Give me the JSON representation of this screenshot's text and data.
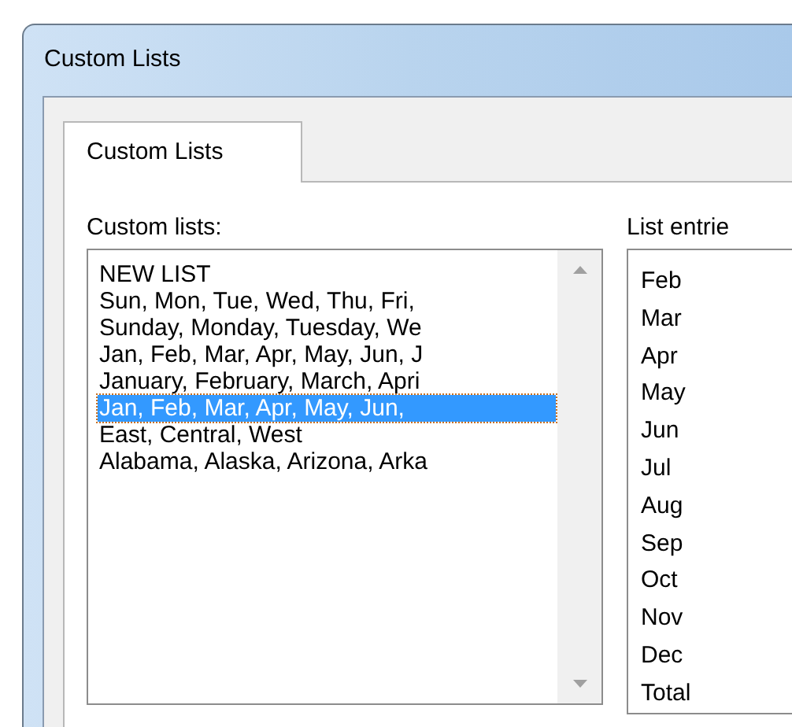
{
  "window": {
    "title": "Custom Lists"
  },
  "tabs": [
    {
      "label": "Custom Lists",
      "selected": true
    }
  ],
  "custom_lists": {
    "label": "Custom lists:",
    "items": [
      {
        "text": "NEW LIST",
        "selected": false
      },
      {
        "text": "Sun, Mon, Tue, Wed, Thu, Fri,",
        "selected": false
      },
      {
        "text": "Sunday, Monday, Tuesday, We",
        "selected": false
      },
      {
        "text": "Jan, Feb, Mar, Apr, May, Jun, J",
        "selected": false
      },
      {
        "text": "January, February, March, Apri",
        "selected": false
      },
      {
        "text": "Jan, Feb, Mar, Apr, May, Jun,",
        "selected": true
      },
      {
        "text": "East, Central, West",
        "selected": false
      },
      {
        "text": "Alabama, Alaska, Arizona, Arka",
        "selected": false
      }
    ]
  },
  "list_entries": {
    "label": "List entrie",
    "entries": [
      "Feb",
      "Mar",
      "Apr",
      "May",
      "Jun",
      "Jul",
      "Aug",
      "Sep",
      "Oct",
      "Nov",
      "Dec",
      "Total"
    ]
  }
}
